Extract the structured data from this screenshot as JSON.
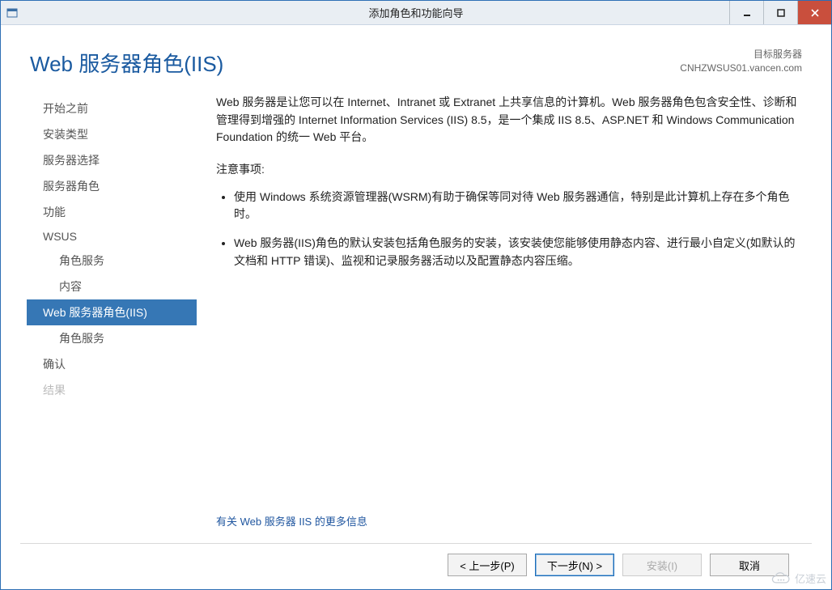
{
  "window": {
    "title": "添加角色和功能向导"
  },
  "header": {
    "page_title": "Web 服务器角色(IIS)",
    "target_label": "目标服务器",
    "target_host": "CNHZWSUS01.vancen.com"
  },
  "sidebar": {
    "items": [
      {
        "label": "开始之前",
        "sub": false,
        "selected": false,
        "disabled": false
      },
      {
        "label": "安装类型",
        "sub": false,
        "selected": false,
        "disabled": false
      },
      {
        "label": "服务器选择",
        "sub": false,
        "selected": false,
        "disabled": false
      },
      {
        "label": "服务器角色",
        "sub": false,
        "selected": false,
        "disabled": false
      },
      {
        "label": "功能",
        "sub": false,
        "selected": false,
        "disabled": false
      },
      {
        "label": "WSUS",
        "sub": false,
        "selected": false,
        "disabled": false
      },
      {
        "label": "角色服务",
        "sub": true,
        "selected": false,
        "disabled": false
      },
      {
        "label": "内容",
        "sub": true,
        "selected": false,
        "disabled": false
      },
      {
        "label": "Web 服务器角色(IIS)",
        "sub": false,
        "selected": true,
        "disabled": false
      },
      {
        "label": "角色服务",
        "sub": true,
        "selected": false,
        "disabled": false
      },
      {
        "label": "确认",
        "sub": false,
        "selected": false,
        "disabled": false
      },
      {
        "label": "结果",
        "sub": false,
        "selected": false,
        "disabled": true
      }
    ]
  },
  "main": {
    "intro": "Web 服务器是让您可以在 Internet、Intranet 或 Extranet 上共享信息的计算机。Web 服务器角色包含安全性、诊断和管理得到增强的 Internet Information Services (IIS) 8.5，是一个集成 IIS 8.5、ASP.NET 和 Windows Communication Foundation 的统一 Web 平台。",
    "notice_title": "注意事项:",
    "bullets": [
      "使用 Windows 系统资源管理器(WSRM)有助于确保等同对待 Web 服务器通信，特别是此计算机上存在多个角色时。",
      "Web 服务器(IIS)角色的默认安装包括角色服务的安装，该安装使您能够使用静态内容、进行最小自定义(如默认的文档和 HTTP 错误)、监视和记录服务器活动以及配置静态内容压缩。"
    ],
    "more_link": "有关 Web 服务器 IIS 的更多信息"
  },
  "footer": {
    "previous": "< 上一步(P)",
    "next": "下一步(N) >",
    "install": "安装(I)",
    "cancel": "取消"
  },
  "watermark": "亿速云"
}
